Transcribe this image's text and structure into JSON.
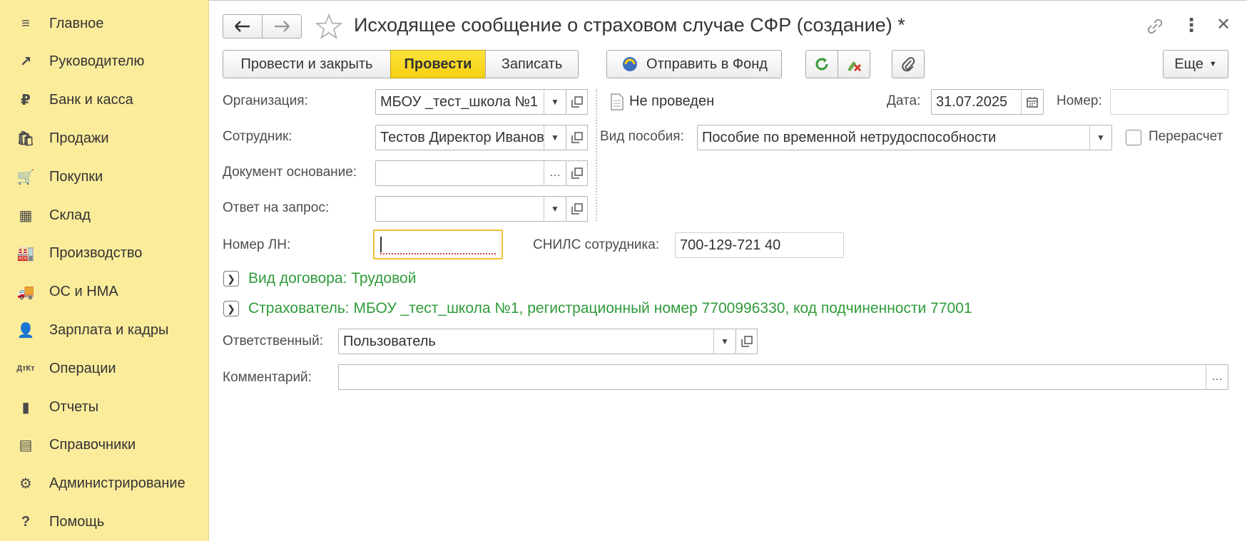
{
  "sidebar": {
    "items": [
      {
        "label": "Главное",
        "icon": "menu-icon",
        "glyph": "≡"
      },
      {
        "label": "Руководителю",
        "icon": "trend-icon",
        "glyph": "↗"
      },
      {
        "label": "Банк и касса",
        "icon": "ruble-icon",
        "glyph": "₽"
      },
      {
        "label": "Продажи",
        "icon": "shopping-bag-icon",
        "glyph": "🛍"
      },
      {
        "label": "Покупки",
        "icon": "cart-icon",
        "glyph": "🛒"
      },
      {
        "label": "Склад",
        "icon": "warehouse-icon",
        "glyph": "▦"
      },
      {
        "label": "Производство",
        "icon": "factory-icon",
        "glyph": "🏭"
      },
      {
        "label": "ОС и НМА",
        "icon": "truck-icon",
        "glyph": "🚚"
      },
      {
        "label": "Зарплата и кадры",
        "icon": "person-icon",
        "glyph": "👤"
      },
      {
        "label": "Операции",
        "icon": "dt-kt-icon",
        "glyph": "ДтКт"
      },
      {
        "label": "Отчеты",
        "icon": "bar-chart-icon",
        "glyph": "▮"
      },
      {
        "label": "Справочники",
        "icon": "books-icon",
        "glyph": "▤"
      },
      {
        "label": "Администрирование",
        "icon": "gear-icon",
        "glyph": "⚙"
      },
      {
        "label": "Помощь",
        "icon": "question-icon",
        "glyph": "?"
      }
    ]
  },
  "header": {
    "title": "Исходящее сообщение о страховом случае СФР (создание) *"
  },
  "toolbar": {
    "post_close": "Провести и закрыть",
    "post": "Провести",
    "save": "Записать",
    "send_fund": "Отправить в Фонд",
    "more": "Еще"
  },
  "form": {
    "org_label": "Организация:",
    "org_value": "МБОУ _тест_школа №1",
    "status": "Не проведен",
    "date_label": "Дата:",
    "date_value": "31.07.2025",
    "number_label": "Номер:",
    "number_value": "",
    "employee_label": "Сотрудник:",
    "employee_value": "Тестов Директор Иванович",
    "benefit_label": "Вид пособия:",
    "benefit_value": "Пособие по временной нетрудоспособности",
    "recalc_label": "Перерасчет",
    "basis_label": "Документ основание:",
    "basis_value": "",
    "reply_label": "Ответ на запрос:",
    "reply_value": "",
    "ln_label": "Номер ЛН:",
    "ln_value": "",
    "snils_label": "СНИЛС сотрудника:",
    "snils_value": "700-129-721 40",
    "contract_link": "Вид договора: Трудовой",
    "insurer_link": "Страхователь: МБОУ _тест_школа №1, регистрационный номер 7700996330, код подчиненности 77001",
    "responsible_label": "Ответственный:",
    "responsible_value": "Пользователь",
    "comment_label": "Комментарий:",
    "comment_value": ""
  },
  "colors": {
    "sidebar_bg": "#fbec9c",
    "primary_button": "#f6cf10",
    "link_green": "#2f9b3a",
    "focus_border": "#f2c12e"
  }
}
